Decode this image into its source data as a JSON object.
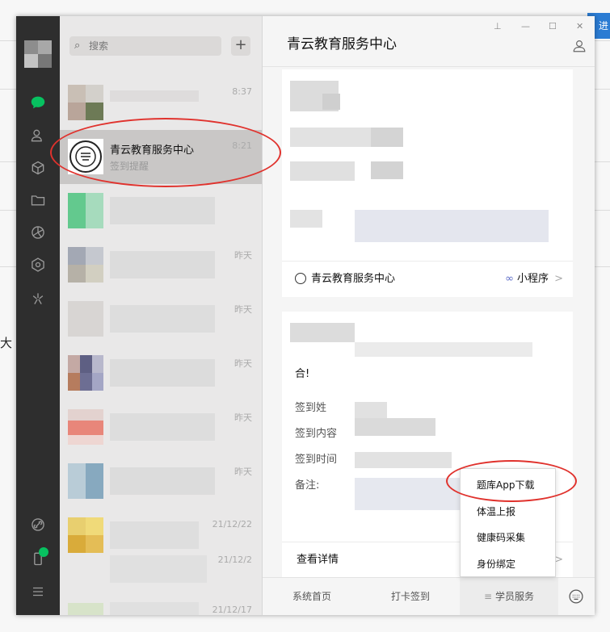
{
  "background": {
    "right_button_glyph": "进",
    "left_text": "大"
  },
  "search": {
    "placeholder": "搜索",
    "icon": "search-icon"
  },
  "add_button": {
    "label": "+"
  },
  "chat_list": [
    {
      "time": "8:37"
    },
    {
      "name": "青云教育服务中心",
      "preview": "签到提醒",
      "time": "8:21",
      "selected": true
    },
    {
      "time": ""
    },
    {
      "time": "昨天"
    },
    {
      "time": "昨天"
    },
    {
      "time": "昨天"
    },
    {
      "time": "昨天"
    },
    {
      "time": "昨天"
    },
    {
      "time": "21/12/22"
    },
    {
      "time": "21/12/2"
    },
    {
      "time": "21/12/17"
    }
  ],
  "main": {
    "title": "青云教育服务中心",
    "window_controls": [
      "⊥",
      "—",
      "☐",
      "✕"
    ],
    "card1": {
      "source_name": "青云教育服务中心",
      "miniprogram_label": "小程序",
      "chevron": ">"
    },
    "card2": {
      "greeting_tail": "合!",
      "fields": [
        "签到姓",
        "签到内容",
        "签到时间",
        "备注:"
      ],
      "detail_label": "查看详情",
      "chevron": ">"
    },
    "bottom_menu": [
      "系统首页",
      "打卡签到",
      "学员服务"
    ],
    "popup_items": [
      "题库App下载",
      "体温上报",
      "健康码采集",
      "身份绑定"
    ]
  },
  "colors": {
    "accent_green": "#07c160",
    "annotation_red": "#e0322d",
    "sidebar": "#2e2e2e"
  }
}
